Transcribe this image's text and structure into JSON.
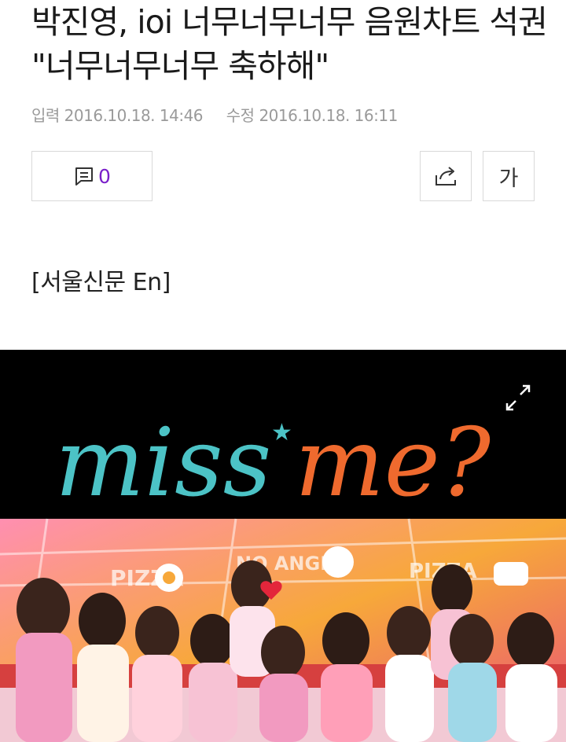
{
  "article": {
    "title": "박진영, ioi 너무너무너무 음원차트 석권 \"너무너무너무 축하해\"",
    "published_label": "입력",
    "published": "2016.10.18. 14:46",
    "modified_label": "수정",
    "modified": "2016.10.18. 16:11",
    "source": "[서울신문 En]"
  },
  "toolbar": {
    "comment_icon": "comment-icon",
    "comment_count": "0",
    "share_icon": "share-icon",
    "font_label": "가"
  },
  "photo": {
    "logo_text": "miss me?",
    "expand_icon": "expand-icon"
  },
  "colors": {
    "accent_comment": "#7a1fc9",
    "logo_teal": "#4cc3c6",
    "logo_orange": "#ef6a2e"
  }
}
